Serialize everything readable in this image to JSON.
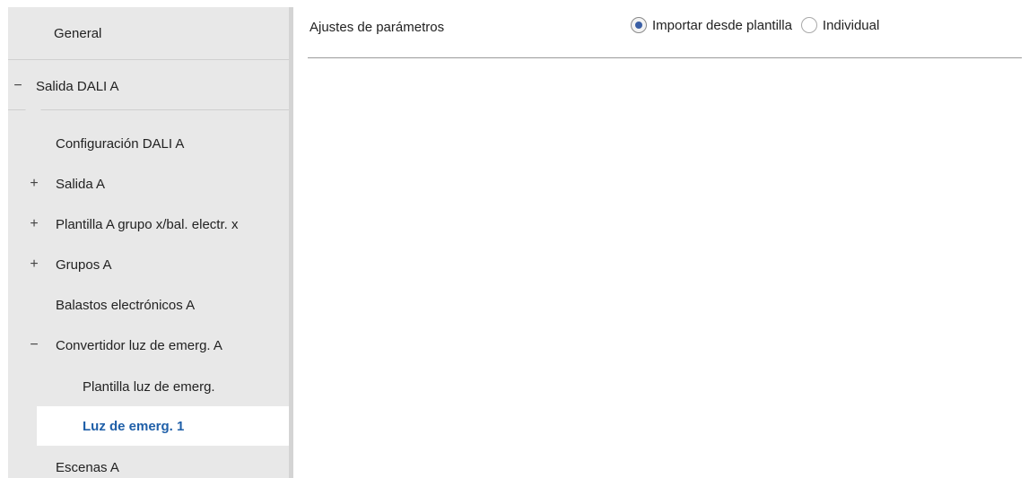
{
  "sidebar": {
    "items": [
      {
        "label": "General",
        "toggle": ""
      },
      {
        "label": "Salida DALI A",
        "toggle": "−"
      },
      {
        "label": "Configuración DALI A",
        "toggle": ""
      },
      {
        "label": "Salida A",
        "toggle": "+"
      },
      {
        "label": "Plantilla A grupo x/bal. electr. x",
        "toggle": "+"
      },
      {
        "label": "Grupos A",
        "toggle": "+"
      },
      {
        "label": "Balastos electrónicos A",
        "toggle": ""
      },
      {
        "label": "Convertidor luz de emerg. A",
        "toggle": "−"
      },
      {
        "label": "Plantilla luz de emerg.",
        "toggle": ""
      },
      {
        "label": "Luz de emerg. 1",
        "toggle": "",
        "selected": true
      },
      {
        "label": "Escenas A",
        "toggle": ""
      }
    ]
  },
  "main": {
    "param_label": "Ajustes de parámetros",
    "radio_options": [
      {
        "label": "Importar desde plantilla",
        "checked": true
      },
      {
        "label": "Individual",
        "checked": false
      }
    ]
  },
  "colors": {
    "selected_text": "#1f5fa8",
    "radio_dot": "#3a5fa5",
    "sidebar_bg": "#e8e8e8"
  }
}
